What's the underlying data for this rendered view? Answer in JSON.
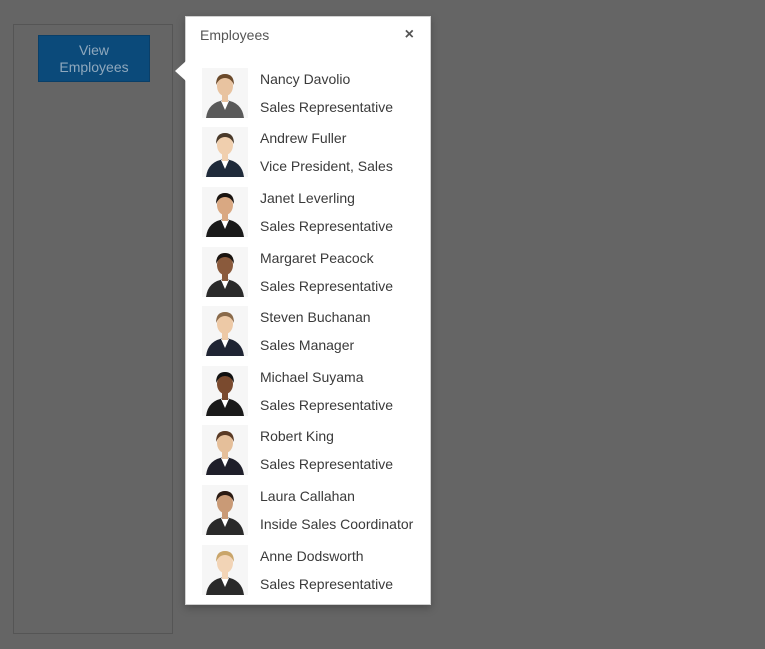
{
  "view_button": {
    "label": "View Employees"
  },
  "popover": {
    "title": "Employees",
    "close_symbol": "×",
    "employees": [
      {
        "name": "Nancy Davolio",
        "title": "Sales Representative",
        "avatar": "female-employee-photo"
      },
      {
        "name": "Andrew Fuller",
        "title": "Vice President, Sales",
        "avatar": "male-employee-photo"
      },
      {
        "name": "Janet Leverling",
        "title": "Sales Representative",
        "avatar": "female-employee-photo"
      },
      {
        "name": "Margaret Peacock",
        "title": "Sales Representative",
        "avatar": "female-employee-photo"
      },
      {
        "name": "Steven Buchanan",
        "title": "Sales Manager",
        "avatar": "male-employee-photo"
      },
      {
        "name": "Michael Suyama",
        "title": "Sales Representative",
        "avatar": "male-employee-photo"
      },
      {
        "name": "Robert King",
        "title": "Sales Representative",
        "avatar": "male-employee-photo"
      },
      {
        "name": "Laura Callahan",
        "title": "Inside Sales Coordinator",
        "avatar": "female-employee-photo"
      },
      {
        "name": "Anne Dodsworth",
        "title": "Sales Representative",
        "avatar": "female-employee-photo"
      }
    ]
  },
  "colors": {
    "overlay_background": "#656565",
    "button_background": "#0b4a7a",
    "popover_background": "#ffffff",
    "text": "#3a3a3a"
  }
}
